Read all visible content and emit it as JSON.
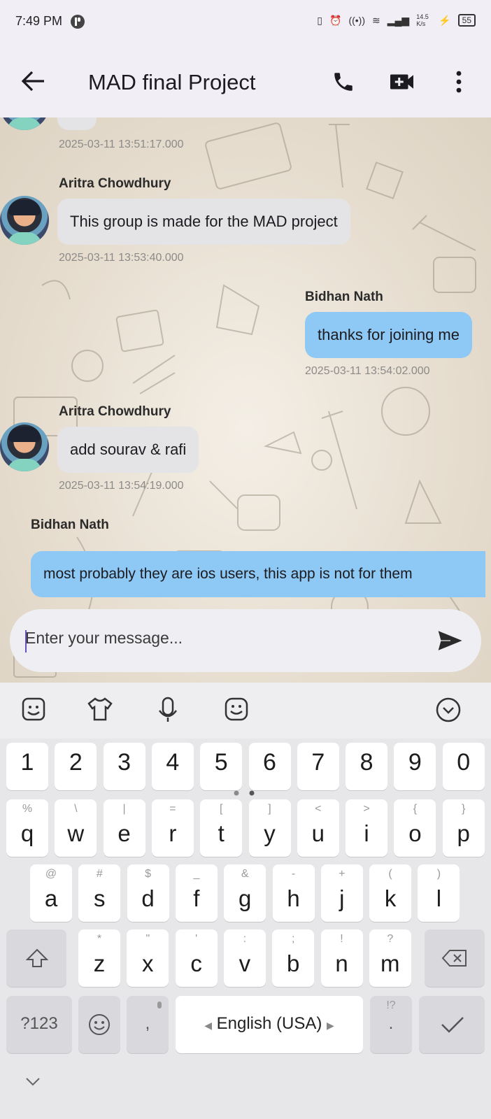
{
  "status_bar": {
    "time": "7:49 PM",
    "battery": "55",
    "speed": "14.5 K/s"
  },
  "app_bar": {
    "title": "MAD final Project",
    "icons": [
      "back-arrow-icon",
      "phone-icon",
      "video-call-icon",
      "more-vert-icon"
    ]
  },
  "messages": [
    {
      "sender": "",
      "text": "",
      "timestamp": "2025-03-11 13:51:17.000",
      "side": "in"
    },
    {
      "sender": "Aritra Chowdhury",
      "text": "This group is made for the MAD project",
      "timestamp": "2025-03-11 13:53:40.000",
      "side": "in"
    },
    {
      "sender": "Bidhan Nath",
      "text": "thanks for joining me",
      "timestamp": "2025-03-11 13:54:02.000",
      "side": "out"
    },
    {
      "sender": "Aritra Chowdhury",
      "text": "add sourav & rafi",
      "timestamp": "2025-03-11 13:54:19.000",
      "side": "in"
    },
    {
      "sender": "Bidhan Nath",
      "text": "most probably they are ios users, this app is not for them",
      "timestamp": "",
      "side": "out"
    }
  ],
  "composer": {
    "placeholder": "Enter your message..."
  },
  "keyboard": {
    "toolbar_icons": [
      "sticker-icon",
      "theme-shirt-icon",
      "microphone-icon",
      "emoji-face-icon",
      "collapse-keyboard-icon"
    ],
    "number_row": [
      "1",
      "2",
      "3",
      "4",
      "5",
      "6",
      "7",
      "8",
      "9",
      "0"
    ],
    "row1": [
      {
        "k": "q",
        "h": "%"
      },
      {
        "k": "w",
        "h": "\\"
      },
      {
        "k": "e",
        "h": "|"
      },
      {
        "k": "r",
        "h": "="
      },
      {
        "k": "t",
        "h": "["
      },
      {
        "k": "y",
        "h": "]"
      },
      {
        "k": "u",
        "h": "<"
      },
      {
        "k": "i",
        "h": ">"
      },
      {
        "k": "o",
        "h": "{"
      },
      {
        "k": "p",
        "h": "}"
      }
    ],
    "row2": [
      {
        "k": "a",
        "h": "@"
      },
      {
        "k": "s",
        "h": "#"
      },
      {
        "k": "d",
        "h": "$"
      },
      {
        "k": "f",
        "h": "_"
      },
      {
        "k": "g",
        "h": "&"
      },
      {
        "k": "h",
        "h": "-"
      },
      {
        "k": "j",
        "h": "+"
      },
      {
        "k": "k",
        "h": "("
      },
      {
        "k": "l",
        "h": ")"
      }
    ],
    "row3": [
      {
        "k": "z",
        "h": "*"
      },
      {
        "k": "x",
        "h": "\""
      },
      {
        "k": "c",
        "h": "'"
      },
      {
        "k": "v",
        "h": ":"
      },
      {
        "k": "b",
        "h": ";"
      },
      {
        "k": "n",
        "h": "!"
      },
      {
        "k": "m",
        "h": "?"
      }
    ],
    "symbols_key": "?123",
    "comma_key": ",",
    "space_label": "English (USA)",
    "period_key": ".",
    "period_hint": "!?"
  }
}
